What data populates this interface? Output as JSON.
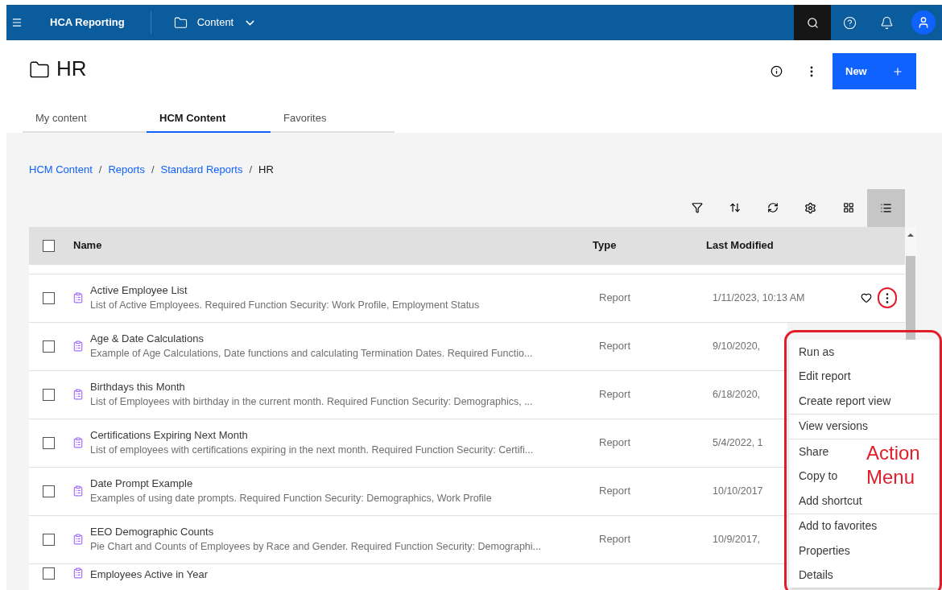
{
  "topbar": {
    "app_name": "HCA Reporting",
    "location": "Content"
  },
  "page": {
    "title": "HR",
    "new_button": "New"
  },
  "tabs": [
    {
      "label": "My content",
      "selected": false
    },
    {
      "label": "HCM Content",
      "selected": true
    },
    {
      "label": "Favorites",
      "selected": false
    }
  ],
  "breadcrumb": [
    {
      "kind": "link",
      "label": "HCM Content"
    },
    {
      "kind": "separator",
      "label": "/"
    },
    {
      "kind": "link",
      "label": "Reports"
    },
    {
      "kind": "separator",
      "label": "/"
    },
    {
      "kind": "link",
      "label": "Standard Reports"
    },
    {
      "kind": "separator",
      "label": "/"
    },
    {
      "kind": "current",
      "label": "HR"
    }
  ],
  "view_toggles": [
    {
      "kind": "grid",
      "selected": false
    },
    {
      "kind": "list",
      "selected": true
    }
  ],
  "table": {
    "select_all_checked": false,
    "columns": [
      "Name",
      "Type",
      "Last Modified"
    ],
    "rows": [
      {
        "name": "Active Employee List",
        "description": "List of Active Employees. Required Function Security: Work Profile, Employment Status",
        "type": "Report",
        "modified": "1/11/2023, 10:13 AM",
        "checked": false,
        "actions_visible": true
      },
      {
        "name": "Age & Date Calculations",
        "description": "Example of Age Calculations, Date functions and calculating Termination Dates. Required Functio...",
        "type": "Report",
        "modified": "9/10/2020,",
        "checked": false
      },
      {
        "name": "Birthdays this Month",
        "description": "List of Employees with birthday in the current month. Required Function Security: Demographics, ...",
        "type": "Report",
        "modified": "6/18/2020,",
        "checked": false
      },
      {
        "name": "Certifications Expiring Next Month",
        "description": "List of employees with certifications expiring in the next month. Required Function Security: Certifi...",
        "type": "Report",
        "modified": "5/4/2022, 1",
        "checked": false
      },
      {
        "name": "Date Prompt Example",
        "description": "Examples of using date prompts. Required Function Security: Demographics, Work Profile",
        "type": "Report",
        "modified": "10/10/2017",
        "checked": false
      },
      {
        "name": "EEO Demographic Counts",
        "description": "Pie Chart and Counts of Employees by Race and Gender. Required Function Security: Demographi...",
        "type": "Report",
        "modified": "10/9/2017,",
        "checked": false
      },
      {
        "name": "Employees Active in Year",
        "checked": false
      }
    ]
  },
  "action_menu": {
    "groups": [
      [
        "Run as",
        "Edit report",
        "Create report view"
      ],
      [
        "View versions"
      ],
      [
        "Share",
        "Copy to",
        "Add shortcut"
      ],
      [
        "Add to favorites",
        "Properties",
        "Details"
      ]
    ]
  },
  "annotation": {
    "label": "Action Menu"
  }
}
